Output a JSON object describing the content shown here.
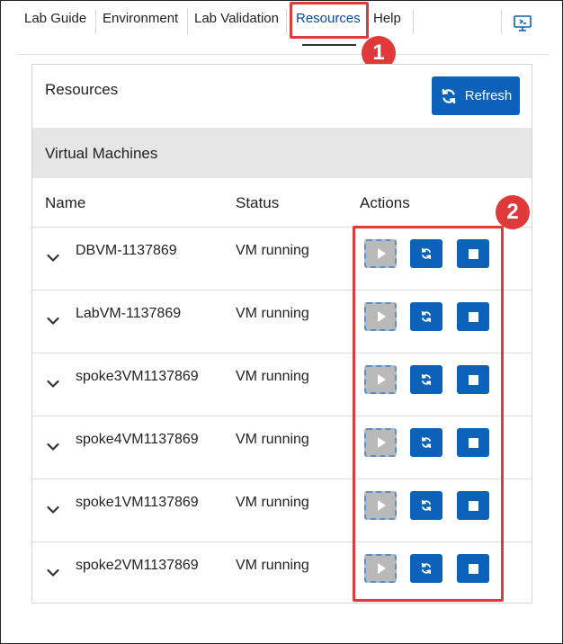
{
  "tabs": [
    {
      "label": "Lab Guide"
    },
    {
      "label": "Environment"
    },
    {
      "label": "Lab Validation"
    },
    {
      "label": "Resources",
      "active": true
    },
    {
      "label": "Help"
    }
  ],
  "annotations": {
    "first": "1",
    "second": "2"
  },
  "panel": {
    "title": "Resources",
    "refresh_label": "Refresh",
    "section_title": "Virtual Machines",
    "columns": {
      "name": "Name",
      "status": "Status",
      "actions": "Actions"
    },
    "vms": [
      {
        "name": "DBVM-1137869",
        "status": "VM running"
      },
      {
        "name": "LabVM-1137869",
        "status": "VM running"
      },
      {
        "name": "spoke3VM1137869",
        "status": "VM running"
      },
      {
        "name": "spoke4VM1137869",
        "status": "VM running"
      },
      {
        "name": "spoke1VM1137869",
        "status": "VM running"
      },
      {
        "name": "spoke2VM1137869",
        "status": "VM running"
      }
    ]
  },
  "colors": {
    "accent": "#0b62b8",
    "annotation": "#e0393a",
    "disabled": "#b9b9b9",
    "section_bg": "#e6e6e6"
  },
  "icons": {
    "display": "screen-share-icon",
    "refresh": "refresh-icon",
    "row_toggle": "chevron-down-icon",
    "start": "play-icon",
    "restart": "restart-icon",
    "stop": "stop-icon"
  }
}
